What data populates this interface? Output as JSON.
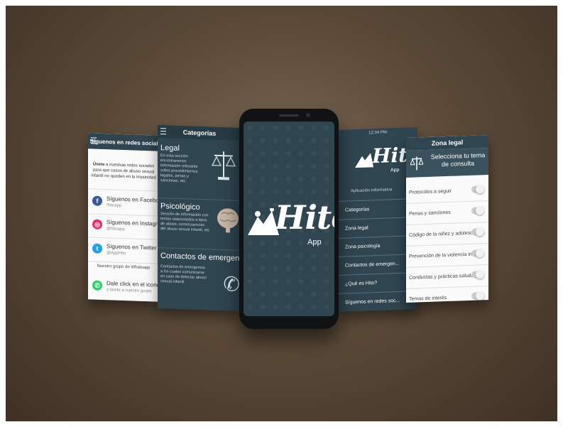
{
  "social": {
    "title": "Síguenos en redes sociales",
    "intro_bold": "Únete",
    "intro_rest": " a nuestras redes sociales para que casos de abuso sexual infantil no queden en la impunidad",
    "facebook": {
      "name": "Síguenos en Facebook",
      "handle": "/hitoapp"
    },
    "instagram": {
      "name": "Síguenos en Instagram",
      "handle": "@hitoapp"
    },
    "twitter": {
      "name": "Síguenos en Twitter",
      "handle": "@AppHito"
    },
    "whatsapp_group": "Nuestro grupo de Whatsapp",
    "whatsapp": {
      "name": "Dale click en el icono",
      "handle": "y únete a nuestro grupo"
    }
  },
  "categories": {
    "title": "Categorías",
    "legal": {
      "heading": "Legal",
      "desc": "En esta sección encontraremos información relevante sobre procedimientos legales, penas y sanciones, etc."
    },
    "psych": {
      "heading": "Psicológico",
      "desc": "Sección de información con temas relacionados a tipos de abuso, consecuencias del abuso sexual infantil, etc"
    },
    "emergency": {
      "heading": "Contactos de emergencia",
      "desc": "Contactos de emergencia a los cuales comunicarse en caso de detectar abuso sexual infantil."
    }
  },
  "logo": {
    "word": "Hito",
    "sub": "App"
  },
  "menu": {
    "status_time": "12:34 PM",
    "items": [
      "Aplicación informativa",
      "Categorías",
      "Zona legal",
      "Zona psicología",
      "Contactos de emergen...",
      "¿Qué es Hito?",
      "Síguenos en redes soc..."
    ]
  },
  "legal_zone": {
    "title": "Zona legal",
    "subtitle": "Selecciona tu tema de consulta",
    "rows": [
      "Protocolos a seguir",
      "Penas y sanciones",
      "Código de la niñez y adolescencia",
      "Prevención de la violencia infantil",
      "Conductas y prácticas saludables",
      "Temas de interés"
    ]
  },
  "colors": {
    "teal": "#2f4550",
    "facebook": "#3b5998",
    "instagram": "#e1306c",
    "twitter": "#1da1f2",
    "whatsapp": "#25d366"
  }
}
